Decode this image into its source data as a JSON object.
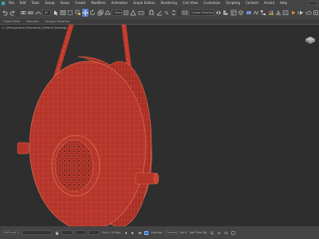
{
  "menubar": {
    "items": [
      "File",
      "Edit",
      "Tools",
      "Group",
      "Views",
      "Create",
      "Modifiers",
      "Animation",
      "Graph Editors",
      "Rendering",
      "Civil View",
      "Customize",
      "Scripting",
      "Content",
      "Arnold",
      "Help"
    ]
  },
  "toolbar": {
    "selection_filter": "All",
    "view_dropdown": "View",
    "selection_set": "Create Selection Se"
  },
  "ribbon": {
    "labels": [
      "Object Paint",
      "Populate",
      "Polygon Modeling"
    ]
  },
  "viewport": {
    "label": "[+] [Perspective] [Standard] [Default Shading]"
  },
  "statusbar": {
    "maxscript": "MAXScript Mi.",
    "grid": "Grid = 10.0cm",
    "add_time_tag": "Add Time Tag",
    "selected_label": "Selected",
    "set_key": "Set K.",
    "autokey_label": "Auto Key"
  },
  "colors": {
    "model_fill": "#b5352a",
    "wire": "#e07055",
    "viewport_bg": "#2e2e2e",
    "ui_bg": "#444444",
    "accent_blue": "#5b7ec2"
  }
}
